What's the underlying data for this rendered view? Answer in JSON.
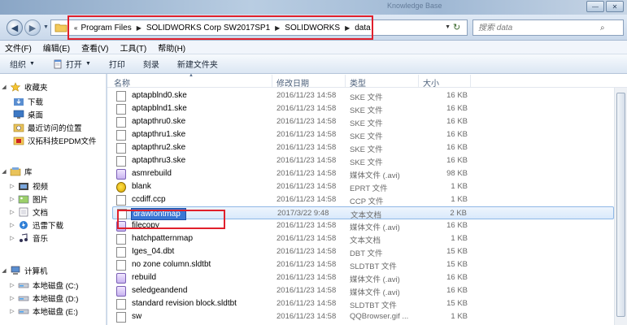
{
  "window": {
    "ghost_title": "Knowledge Base"
  },
  "address": {
    "crumbs": [
      "Program Files",
      "SOLIDWORKS Corp SW2017SP1",
      "SOLIDWORKS",
      "data"
    ],
    "search_placeholder": "搜索 data"
  },
  "menu": [
    "文件(F)",
    "编辑(E)",
    "查看(V)",
    "工具(T)",
    "帮助(H)"
  ],
  "toolbar": {
    "organize": "组织",
    "open": "打开",
    "print": "打印",
    "burn": "刻录",
    "new_folder": "新建文件夹"
  },
  "nav": {
    "favorites": "收藏夹",
    "downloads": "下载",
    "desktop": "桌面",
    "recent": "最近访问的位置",
    "hantuo": "汉拓科技EPDM文件",
    "libraries": "库",
    "videos": "视频",
    "pictures": "图片",
    "documents": "文档",
    "xunlei": "迅雷下载",
    "music": "音乐",
    "computer": "计算机",
    "disk_c": "本地磁盘 (C:)",
    "disk_d": "本地磁盘 (D:)",
    "disk_e": "本地磁盘 (E:)"
  },
  "columns": {
    "name": "名称",
    "modified": "修改日期",
    "type": "类型",
    "size": "大小"
  },
  "files": [
    {
      "name": "aptapblnd0.ske",
      "date": "2016/11/23 14:58",
      "type": "SKE 文件",
      "size": "16 KB",
      "icon": "doc"
    },
    {
      "name": "aptapblnd1.ske",
      "date": "2016/11/23 14:58",
      "type": "SKE 文件",
      "size": "16 KB",
      "icon": "doc"
    },
    {
      "name": "aptapthru0.ske",
      "date": "2016/11/23 14:58",
      "type": "SKE 文件",
      "size": "16 KB",
      "icon": "doc"
    },
    {
      "name": "aptapthru1.ske",
      "date": "2016/11/23 14:58",
      "type": "SKE 文件",
      "size": "16 KB",
      "icon": "doc"
    },
    {
      "name": "aptapthru2.ske",
      "date": "2016/11/23 14:58",
      "type": "SKE 文件",
      "size": "16 KB",
      "icon": "doc"
    },
    {
      "name": "aptapthru3.ske",
      "date": "2016/11/23 14:58",
      "type": "SKE 文件",
      "size": "16 KB",
      "icon": "doc"
    },
    {
      "name": "asmrebuild",
      "date": "2016/11/23 14:58",
      "type": "媒体文件 (.avi)",
      "size": "98 KB",
      "icon": "media"
    },
    {
      "name": "blank",
      "date": "2016/11/23 14:58",
      "type": "EPRT 文件",
      "size": "1 KB",
      "icon": "eprt"
    },
    {
      "name": "ccdiff.ccp",
      "date": "2016/11/23 14:58",
      "type": "CCP 文件",
      "size": "1 KB",
      "icon": "doc"
    },
    {
      "name": "drawfontmap",
      "date": "2017/3/22 9:48",
      "type": "文本文档",
      "size": "2 KB",
      "icon": "doc",
      "selected": true
    },
    {
      "name": "filecopy",
      "date": "2016/11/23 14:58",
      "type": "媒体文件 (.avi)",
      "size": "16 KB",
      "icon": "media"
    },
    {
      "name": "hatchpatternmap",
      "date": "2016/11/23 14:58",
      "type": "文本文档",
      "size": "1 KB",
      "icon": "doc"
    },
    {
      "name": "Iges_04.dbt",
      "date": "2016/11/23 14:58",
      "type": "DBT 文件",
      "size": "15 KB",
      "icon": "doc"
    },
    {
      "name": "no zone column.sldtbt",
      "date": "2016/11/23 14:58",
      "type": "SLDTBT 文件",
      "size": "15 KB",
      "icon": "doc"
    },
    {
      "name": "rebuild",
      "date": "2016/11/23 14:58",
      "type": "媒体文件 (.avi)",
      "size": "16 KB",
      "icon": "media"
    },
    {
      "name": "seledgeandend",
      "date": "2016/11/23 14:58",
      "type": "媒体文件 (.avi)",
      "size": "16 KB",
      "icon": "media"
    },
    {
      "name": "standard revision block.sldtbt",
      "date": "2016/11/23 14:58",
      "type": "SLDTBT 文件",
      "size": "15 KB",
      "icon": "doc"
    },
    {
      "name": "sw",
      "date": "2016/11/23 14:58",
      "type": "QQBrowser.gif ...",
      "size": "1 KB",
      "icon": "doc"
    }
  ]
}
